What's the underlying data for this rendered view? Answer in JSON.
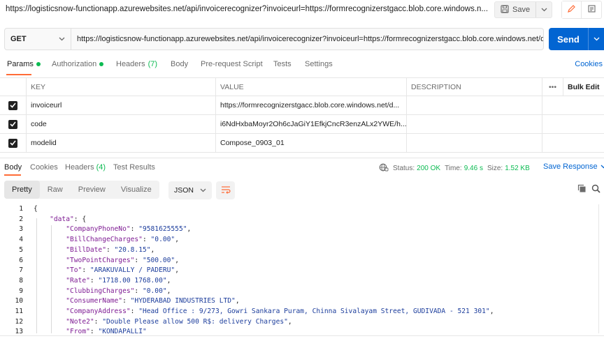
{
  "title_url": "https://logisticsnow-functionapp.azurewebsites.net/api/invoicerecognizer?invoiceurl=https://formrecognizerstgacc.blob.core.windows.n...",
  "toolbar": {
    "save_label": "Save"
  },
  "request": {
    "method": "GET",
    "url": "https://logisticsnow-functionapp.azurewebsites.net/api/invoicerecognizer?invoiceurl=https://formrecognizerstgacc.blob.core.windows.net/da...",
    "send_label": "Send"
  },
  "request_tabs": {
    "params": "Params",
    "authorization": "Authorization",
    "headers": "Headers",
    "headers_count": "(7)",
    "body": "Body",
    "prerequest": "Pre-request Script",
    "tests": "Tests",
    "settings": "Settings",
    "cookies": "Cookies"
  },
  "params_table": {
    "headers": {
      "key": "KEY",
      "value": "VALUE",
      "description": "DESCRIPTION",
      "more": "•••",
      "bulk_edit": "Bulk Edit"
    },
    "rows": [
      {
        "key": "invoiceurl",
        "value": "https://formrecognizerstgacc.blob.core.windows.net/d...",
        "description": ""
      },
      {
        "key": "code",
        "value": "i6NdHxbaMoyr2Oh6cJaGiY1EfkjCncR3enzALx2YWE/h...",
        "description": ""
      },
      {
        "key": "modelid",
        "value": "Compose_0903_01",
        "description": ""
      }
    ]
  },
  "response_tabs": {
    "body": "Body",
    "cookies": "Cookies",
    "headers": "Headers",
    "headers_count": "(4)",
    "test_results": "Test Results"
  },
  "response_status": {
    "status_label": "Status:",
    "status_value": "200 OK",
    "time_label": "Time:",
    "time_value": "9.46 s",
    "size_label": "Size:",
    "size_value": "1.52 KB",
    "save_response": "Save Response"
  },
  "format_tabs": [
    "Pretty",
    "Raw",
    "Preview",
    "Visualize"
  ],
  "format_select": "JSON",
  "code_lines": [
    {
      "n": "1",
      "parts": [
        [
          "p",
          "{"
        ]
      ]
    },
    {
      "n": "2",
      "parts": [
        [
          "p",
          "    "
        ],
        [
          "k",
          "\"data\""
        ],
        [
          "p",
          ": {"
        ]
      ]
    },
    {
      "n": "3",
      "parts": [
        [
          "p",
          "        "
        ],
        [
          "k",
          "\"CompanyPhoneNo\""
        ],
        [
          "p",
          ": "
        ],
        [
          "s",
          "\"9581625555\""
        ],
        [
          "p",
          ","
        ]
      ]
    },
    {
      "n": "4",
      "parts": [
        [
          "p",
          "        "
        ],
        [
          "k",
          "\"BillChangeCharges\""
        ],
        [
          "p",
          ": "
        ],
        [
          "s",
          "\"0.00\""
        ],
        [
          "p",
          ","
        ]
      ]
    },
    {
      "n": "5",
      "parts": [
        [
          "p",
          "        "
        ],
        [
          "k",
          "\"BillDate\""
        ],
        [
          "p",
          ": "
        ],
        [
          "s",
          "\"20.8.15\""
        ],
        [
          "p",
          ","
        ]
      ]
    },
    {
      "n": "6",
      "parts": [
        [
          "p",
          "        "
        ],
        [
          "k",
          "\"TwoPointCharges\""
        ],
        [
          "p",
          ": "
        ],
        [
          "s",
          "\"500.00\""
        ],
        [
          "p",
          ","
        ]
      ]
    },
    {
      "n": "7",
      "parts": [
        [
          "p",
          "        "
        ],
        [
          "k",
          "\"To\""
        ],
        [
          "p",
          ": "
        ],
        [
          "s",
          "\"ARAKUVALLY / PADERU\""
        ],
        [
          "p",
          ","
        ]
      ]
    },
    {
      "n": "8",
      "parts": [
        [
          "p",
          "        "
        ],
        [
          "k",
          "\"Rate\""
        ],
        [
          "p",
          ": "
        ],
        [
          "s",
          "\"1718.00 1768.00\""
        ],
        [
          "p",
          ","
        ]
      ]
    },
    {
      "n": "9",
      "parts": [
        [
          "p",
          "        "
        ],
        [
          "k",
          "\"ClubbingCharges\""
        ],
        [
          "p",
          ": "
        ],
        [
          "s",
          "\"0.00\""
        ],
        [
          "p",
          ","
        ]
      ]
    },
    {
      "n": "10",
      "parts": [
        [
          "p",
          "        "
        ],
        [
          "k",
          "\"ConsumerName\""
        ],
        [
          "p",
          ": "
        ],
        [
          "s",
          "\"HYDERABAD INDUSTRIES LTD\""
        ],
        [
          "p",
          ","
        ]
      ]
    },
    {
      "n": "11",
      "parts": [
        [
          "p",
          "        "
        ],
        [
          "k",
          "\"CompanyAddress\""
        ],
        [
          "p",
          ": "
        ],
        [
          "s",
          "\"Head Office : 9/273, Gowri Sankara Puram, Chinna Sivalayam Street, GUDIVADA - 521 301\""
        ],
        [
          "p",
          ","
        ]
      ]
    },
    {
      "n": "12",
      "parts": [
        [
          "p",
          "        "
        ],
        [
          "k",
          "\"Note2\""
        ],
        [
          "p",
          ": "
        ],
        [
          "s",
          "\"Double Please allow 500 R$: delivery Charges\""
        ],
        [
          "p",
          ","
        ]
      ]
    },
    {
      "n": "13",
      "parts": [
        [
          "p",
          "        "
        ],
        [
          "k",
          "\"From\""
        ],
        [
          "p",
          ": "
        ],
        [
          "s",
          "\"KONDAPALLI\""
        ]
      ]
    }
  ],
  "colors": {
    "accent": "#0265d2",
    "tab_underline": "#ff6c37",
    "success": "#0cbb52",
    "json_key": "#7e1b93",
    "json_string": "#1c3d9c"
  }
}
